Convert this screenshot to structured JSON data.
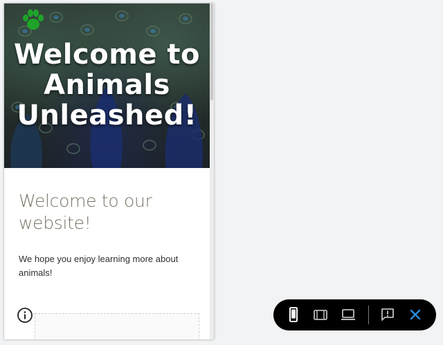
{
  "preview": {
    "hero_title": "Welcome to Animals Unleashed!",
    "welcome_heading": "Welcome to our website!",
    "welcome_text": "We hope you enjoy learning more about animals!"
  },
  "icons": {
    "logo": "paw-icon",
    "info": "info-icon"
  },
  "toolbar": {
    "buttons": [
      "mobile-view-icon",
      "tablet-view-icon",
      "desktop-view-icon",
      "feedback-icon",
      "close-icon"
    ],
    "active_button": "mobile-view-icon"
  },
  "colors": {
    "paw": "#1fa32a",
    "heading": "#7a7466",
    "toolbar_bg": "#000000",
    "close_accent": "#2b8de0"
  }
}
